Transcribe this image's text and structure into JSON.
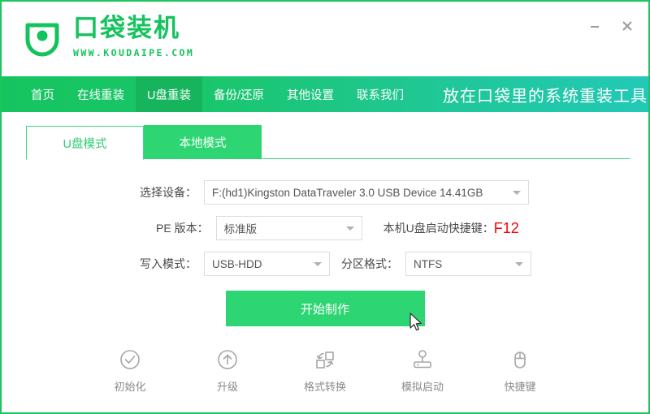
{
  "window": {
    "minimize_label": "—",
    "close_label": "×",
    "border_color": "#1ec45f"
  },
  "brand": {
    "name": "口袋装机",
    "url": "WWW.KOUDAIPE.COM",
    "logo_icon": "shield-dot-logo",
    "color": "#14c35d"
  },
  "nav": {
    "items": [
      {
        "label": "首页",
        "active": false
      },
      {
        "label": "在线重装",
        "active": false
      },
      {
        "label": "U盘重装",
        "active": true
      },
      {
        "label": "备份/还原",
        "active": false
      },
      {
        "label": "其他设置",
        "active": false
      },
      {
        "label": "联系我们",
        "active": false
      }
    ],
    "slogan": "放在口袋里的系统重装工具",
    "gradient_start": "#15c45f",
    "gradient_end": "#22c9b6",
    "active_bg": "#16b45d"
  },
  "tabs": [
    {
      "label": "U盘模式",
      "active": true
    },
    {
      "label": "本地模式",
      "active": false
    }
  ],
  "form": {
    "device": {
      "label": "选择设备：",
      "value": "F:(hd1)Kingston DataTraveler 3.0 USB Device 14.41GB"
    },
    "pe_version": {
      "label": "PE 版本：",
      "value": "标准版"
    },
    "hotkey": {
      "label": "本机U盘启动快捷键：",
      "key": "F12",
      "key_color": "#ff0000"
    },
    "write_mode": {
      "label": "写入模式：",
      "value": "USB-HDD"
    },
    "partition_format": {
      "label": "分区格式：",
      "value": "NTFS"
    }
  },
  "cta": {
    "label": "开始制作",
    "color": "#2ed573"
  },
  "tools": [
    {
      "label": "初始化",
      "icon": "check-circle-icon"
    },
    {
      "label": "升级",
      "icon": "arrow-up-circle-icon"
    },
    {
      "label": "格式转换",
      "icon": "format-convert-icon"
    },
    {
      "label": "模拟启动",
      "icon": "joystick-icon"
    },
    {
      "label": "快捷键",
      "icon": "mouse-icon"
    }
  ]
}
